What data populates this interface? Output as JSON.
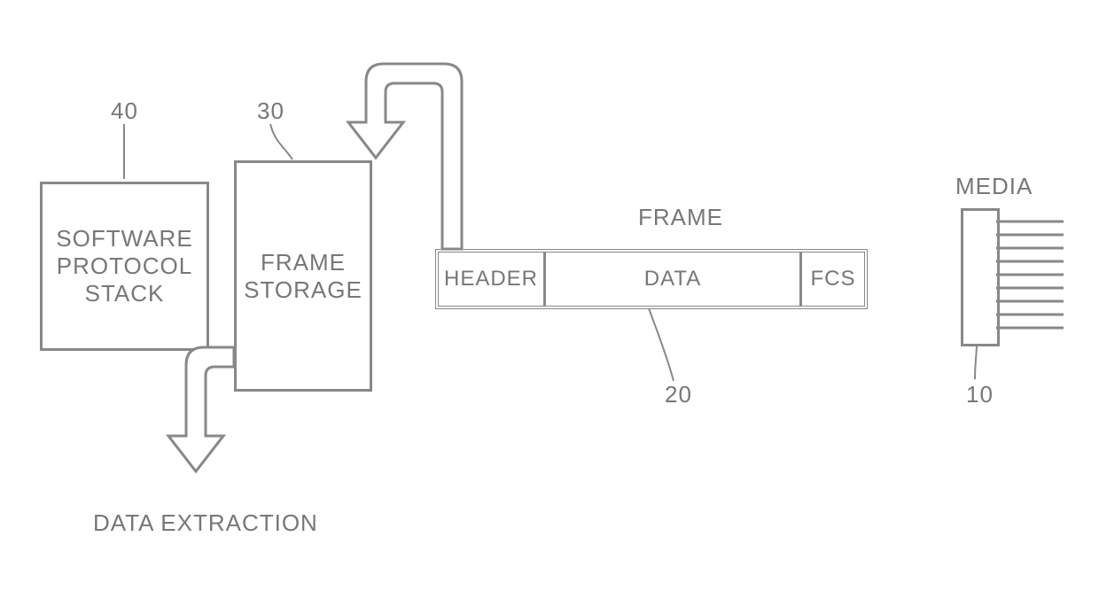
{
  "labels": {
    "media": "MEDIA",
    "frame": "FRAME",
    "header": "HEADER",
    "data": "DATA",
    "fcs": "FCS",
    "frame_storage": "FRAME\nSTORAGE",
    "software_stack": "SOFTWARE\nPROTOCOL\nSTACK",
    "data_extraction": "DATA EXTRACTION"
  },
  "refs": {
    "media_ref": "10",
    "frame_ref": "20",
    "storage_ref": "30",
    "stack_ref": "40"
  }
}
